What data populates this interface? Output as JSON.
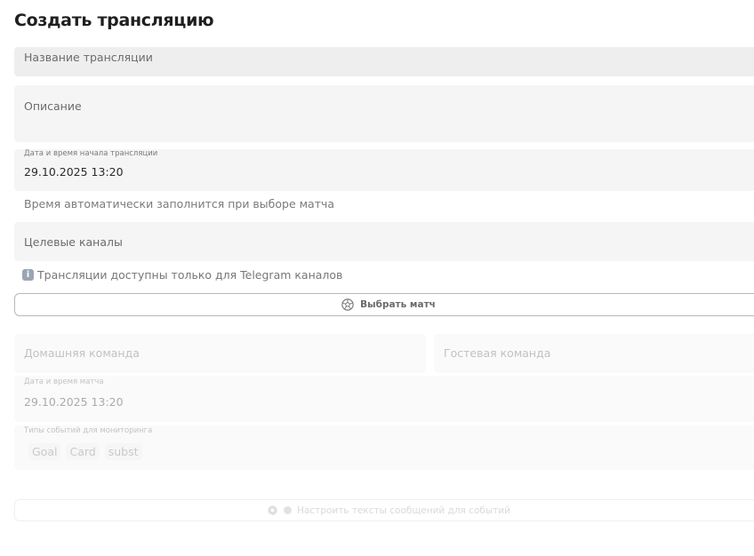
{
  "page": {
    "title": "Создать трансляцию"
  },
  "form": {
    "name_placeholder": "Название трансляции",
    "description_placeholder": "Описание",
    "start_label": "Дата и время начала трансляции",
    "start_value": "29.10.2025 13:20",
    "start_hint": "Время автоматически заполнится при выборе матча",
    "channels_placeholder": "Целевые каналы",
    "channels_info": "Трансляции доступны только для Telegram каналов",
    "select_match_label": "Выбрать матч"
  },
  "match": {
    "home_placeholder": "Домашняя команда",
    "guest_placeholder": "Гостевая команда",
    "date_label": "Дата и время матча",
    "date_value": "29.10.2025 13:20",
    "events_label": "Типы событий для мониторинга",
    "events": [
      "Goal",
      "Card",
      "subst"
    ],
    "configure_texts_label": "Настроить тексты сообщений для событий"
  },
  "icons": {
    "info": "info-icon",
    "ball": "soccer-ball-icon",
    "gear": "gear-icon"
  },
  "colors": {
    "field_bg": "#f5f5f5",
    "info_icon": "#9aa5b4",
    "button_border": "#b8b8b8"
  }
}
